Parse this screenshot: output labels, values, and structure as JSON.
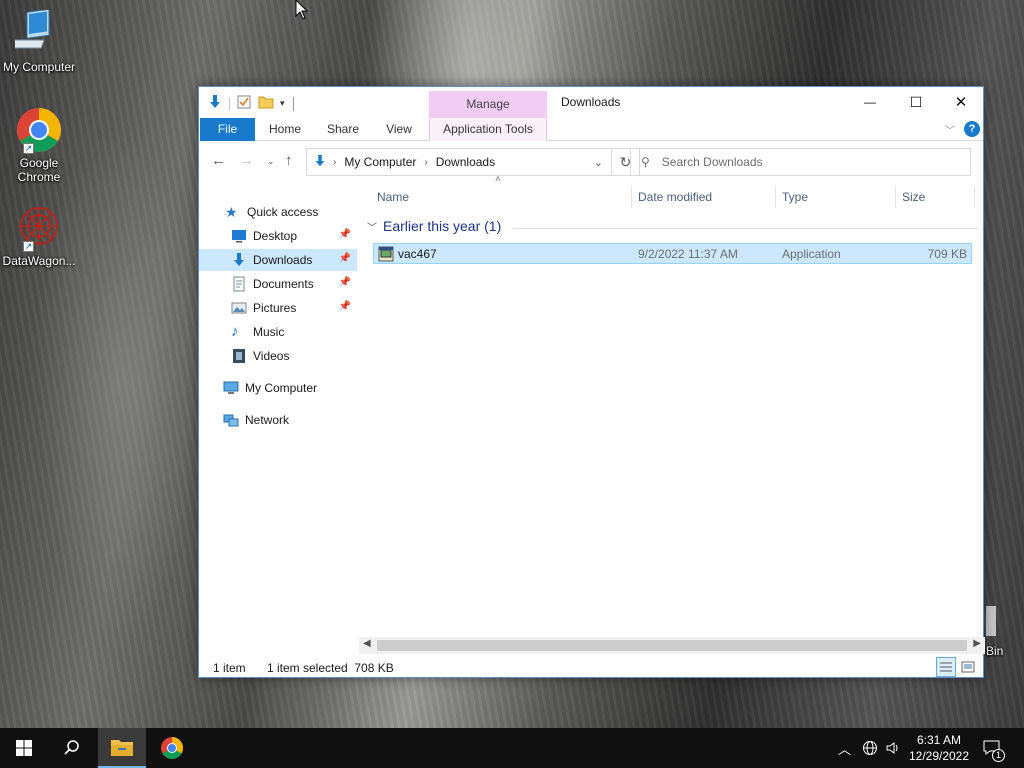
{
  "desktop": {
    "icons": [
      {
        "label": "My Computer"
      },
      {
        "label": "Google Chrome"
      },
      {
        "label": "DataWagon..."
      }
    ],
    "recycle_bin_partial": "Bin"
  },
  "window": {
    "title": "Downloads",
    "context_tab": "Manage",
    "ribbon_tabs": [
      "File",
      "Home",
      "Share",
      "View",
      "Application Tools"
    ],
    "controls": {
      "minimize": "—",
      "maximize": "☐",
      "close": "✕"
    }
  },
  "address": {
    "path": [
      "My Computer",
      "Downloads"
    ],
    "search_placeholder": "Search Downloads"
  },
  "nav": {
    "quick_access": "Quick access",
    "items": [
      {
        "label": "Desktop",
        "pinned": true
      },
      {
        "label": "Downloads",
        "pinned": true,
        "selected": true
      },
      {
        "label": "Documents",
        "pinned": true
      },
      {
        "label": "Pictures",
        "pinned": true
      },
      {
        "label": "Music",
        "pinned": false
      },
      {
        "label": "Videos",
        "pinned": false
      }
    ],
    "my_computer": "My Computer",
    "network": "Network"
  },
  "columns": {
    "name": "Name",
    "date": "Date modified",
    "type": "Type",
    "size": "Size"
  },
  "group": {
    "label": "Earlier this year (1)"
  },
  "files": [
    {
      "name": "vac467",
      "date": "9/2/2022 11:37 AM",
      "type": "Application",
      "size": "709 KB"
    }
  ],
  "status": {
    "count": "1 item",
    "selection": "1 item selected  708 KB"
  },
  "taskbar": {
    "time": "6:31 AM",
    "date": "12/29/2022",
    "notification_count": "1"
  },
  "colors": {
    "accent": "#1979ca",
    "selection": "#cce8ff",
    "manage_tab": "#f1ccf4"
  }
}
